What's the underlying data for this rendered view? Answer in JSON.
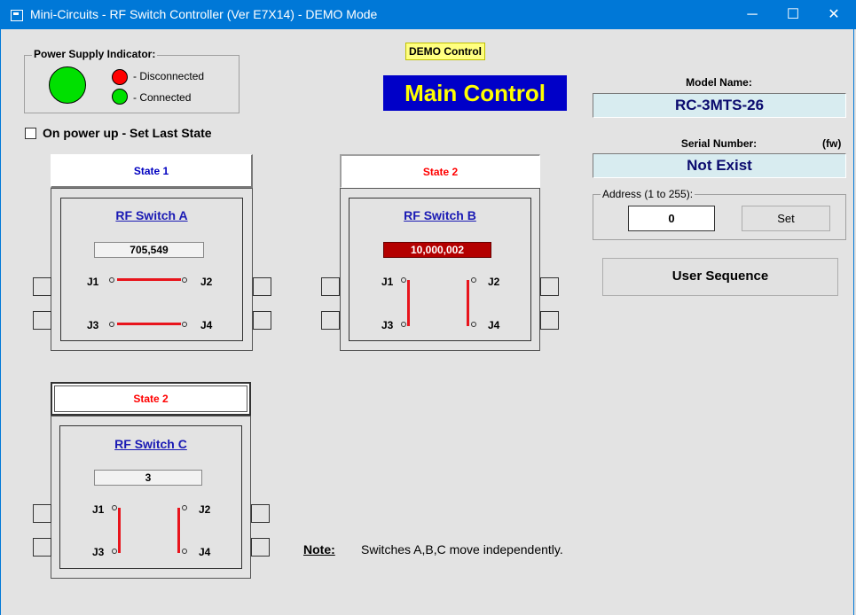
{
  "window": {
    "title": "Mini-Circuits -  RF Switch Controller   (Ver E7X14)  - DEMO Mode",
    "minimize": "─",
    "maximize": "☐",
    "close": "✕",
    "titlebar_color": "#0078d7"
  },
  "power": {
    "group_label": "Power Supply Indicator:",
    "disconnected_label": "- Disconnected",
    "connected_label": "- Connected",
    "status": "Connected",
    "colors": {
      "on": "#00e000",
      "off": "#ff0000"
    }
  },
  "power_up": {
    "label": "On power up - Set Last State",
    "checked": false
  },
  "demo_badge": "DEMO Control",
  "main_control": "Main Control",
  "model": {
    "label": "Model Name:",
    "value": "RC-3MTS-26"
  },
  "serial": {
    "label": "Serial Number:",
    "fw_label": "(fw)",
    "value": "Not Exist"
  },
  "address": {
    "group_label": "Address (1 to 255):",
    "value": "0",
    "set_label": "Set"
  },
  "user_sequence_label": "User Sequence",
  "switches": [
    {
      "state_label": "State 1",
      "state_color": "#0000c0",
      "name": "RF Switch A",
      "counter": "705,549",
      "counter_highlight": false,
      "j1": "J1",
      "j2": "J2",
      "j3": "J3",
      "j4": "J4"
    },
    {
      "state_label": "State 2",
      "state_color": "#ff0000",
      "name": "RF Switch B",
      "counter": "10,000,002",
      "counter_highlight": true,
      "j1": "J1",
      "j2": "J2",
      "j3": "J3",
      "j4": "J4"
    },
    {
      "state_label": "State 2",
      "state_color": "#ff0000",
      "name": "RF Switch C",
      "counter": "3",
      "counter_highlight": false,
      "j1": "J1",
      "j2": "J2",
      "j3": "J3",
      "j4": "J4"
    }
  ],
  "note": {
    "label": "Note:",
    "text": "Switches A,B,C move independently."
  }
}
